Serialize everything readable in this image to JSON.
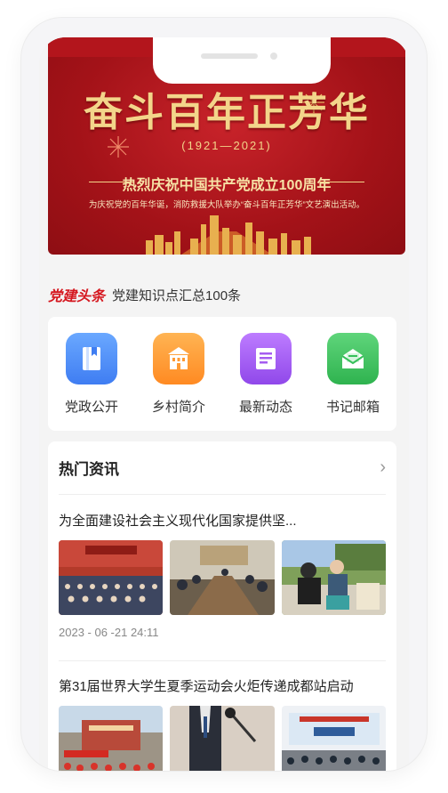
{
  "banner": {
    "title": "奋斗百年正芳华",
    "years": "(1921—2021)",
    "subtitle": "热烈庆祝中国共产党成立100周年",
    "description": "为庆祝党的百年华诞，消防救援大队举办“奋斗百年正芳华”文艺演出活动。"
  },
  "headline": {
    "tag": "党建头条",
    "text": "党建知识点汇总100条"
  },
  "nav": [
    {
      "label": "党政公开",
      "icon": "book-icon",
      "color": "#4d8ef7"
    },
    {
      "label": "乡村简介",
      "icon": "building-icon",
      "color": "#ff9a33"
    },
    {
      "label": "最新动态",
      "icon": "document-icon",
      "color": "#a55cf0"
    },
    {
      "label": "书记邮箱",
      "icon": "mail-icon",
      "color": "#37c05a"
    }
  ],
  "news": {
    "title": "热门资讯",
    "items": [
      {
        "title": "为全面建设社会主义现代化国家提供坚...",
        "date": "2023 - 06 -21  24:11"
      },
      {
        "title": "第31届世界大学生夏季运动会火炬传递成都站启动",
        "date": ""
      }
    ]
  },
  "colors": {
    "accent": "#d5171f",
    "banner_red": "#b3151c",
    "gold": "#f3d58a"
  }
}
